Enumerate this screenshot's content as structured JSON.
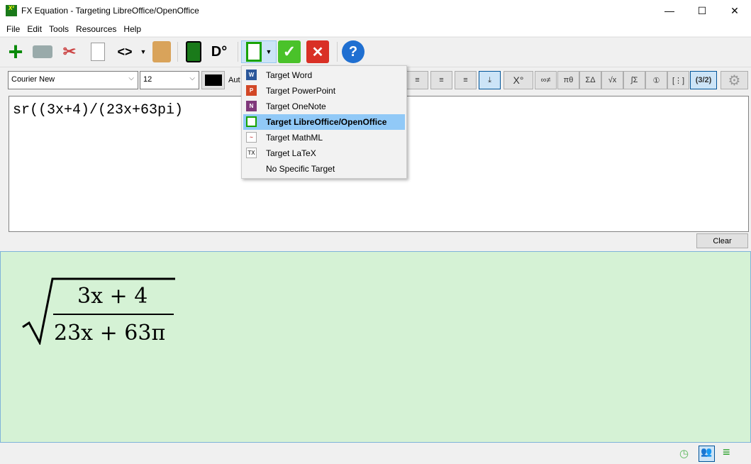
{
  "window": {
    "title": "FX Equation - Targeting LibreOffice/OpenOffice",
    "minimize": "—",
    "maximize": "☐",
    "close": "✕"
  },
  "menu": [
    {
      "label": "File",
      "key": "F"
    },
    {
      "label": "Edit",
      "key": "E"
    },
    {
      "label": "Tools",
      "key": "T"
    },
    {
      "label": "Resources",
      "key": "R"
    },
    {
      "label": "Help",
      "key": "H"
    }
  ],
  "format": {
    "font": "Courier New",
    "size": "12",
    "color": "#000000",
    "auto_label": "Aut"
  },
  "editor": {
    "text": "sr((3x+4)/(23x+63pi)"
  },
  "clear_label": "Clear",
  "target_menu": {
    "items": [
      "Target Word",
      "Target PowerPoint",
      "Target OneNote",
      "Target LibreOffice/OpenOffice",
      "Target MathML",
      "Target LaTeX",
      "No Specific Target"
    ],
    "selected": "Target LibreOffice/OpenOffice"
  },
  "preview": {
    "numerator": "3x + 4",
    "denominator": "23x + 63π",
    "background": "#d5f2d5"
  },
  "fmt_buttons": {
    "superscript": "X°",
    "matrix": "(3/2)"
  }
}
